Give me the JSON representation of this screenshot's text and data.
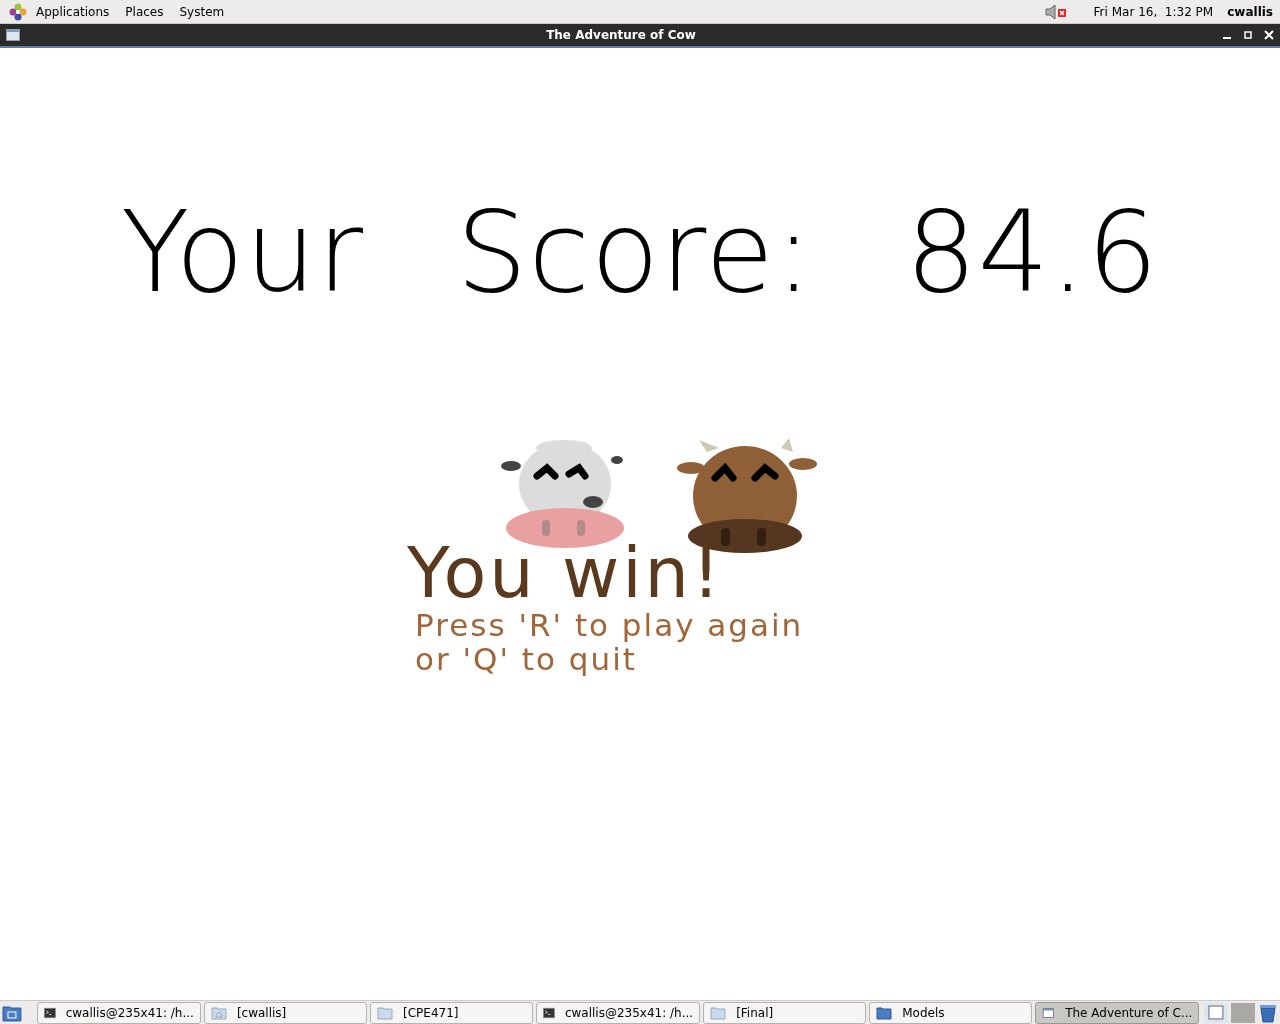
{
  "top_panel": {
    "menus": [
      "Applications",
      "Places",
      "System"
    ],
    "clock": "Fri Mar 16,  1:32 PM",
    "user": "cwallis"
  },
  "window": {
    "title": "The Adventure of Cow"
  },
  "game": {
    "score_words": [
      "Your",
      "Score:",
      "84.6"
    ],
    "headline": "You win!",
    "instructions": [
      "Press 'R' to play again",
      "or 'Q' to quit"
    ]
  },
  "taskbar": {
    "items": [
      {
        "kind": "terminal",
        "label": "cwallis@235x41: /h...",
        "selected": false
      },
      {
        "kind": "home",
        "label": "[cwallis]",
        "selected": false
      },
      {
        "kind": "folder",
        "label": "[CPE471]",
        "selected": false
      },
      {
        "kind": "terminal",
        "label": "cwallis@235x41: /h...",
        "selected": false
      },
      {
        "kind": "folder",
        "label": "[Final]",
        "selected": false
      },
      {
        "kind": "folder-dark",
        "label": "Models",
        "selected": false
      },
      {
        "kind": "window",
        "label": "The Adventure of C...",
        "selected": true
      }
    ]
  }
}
